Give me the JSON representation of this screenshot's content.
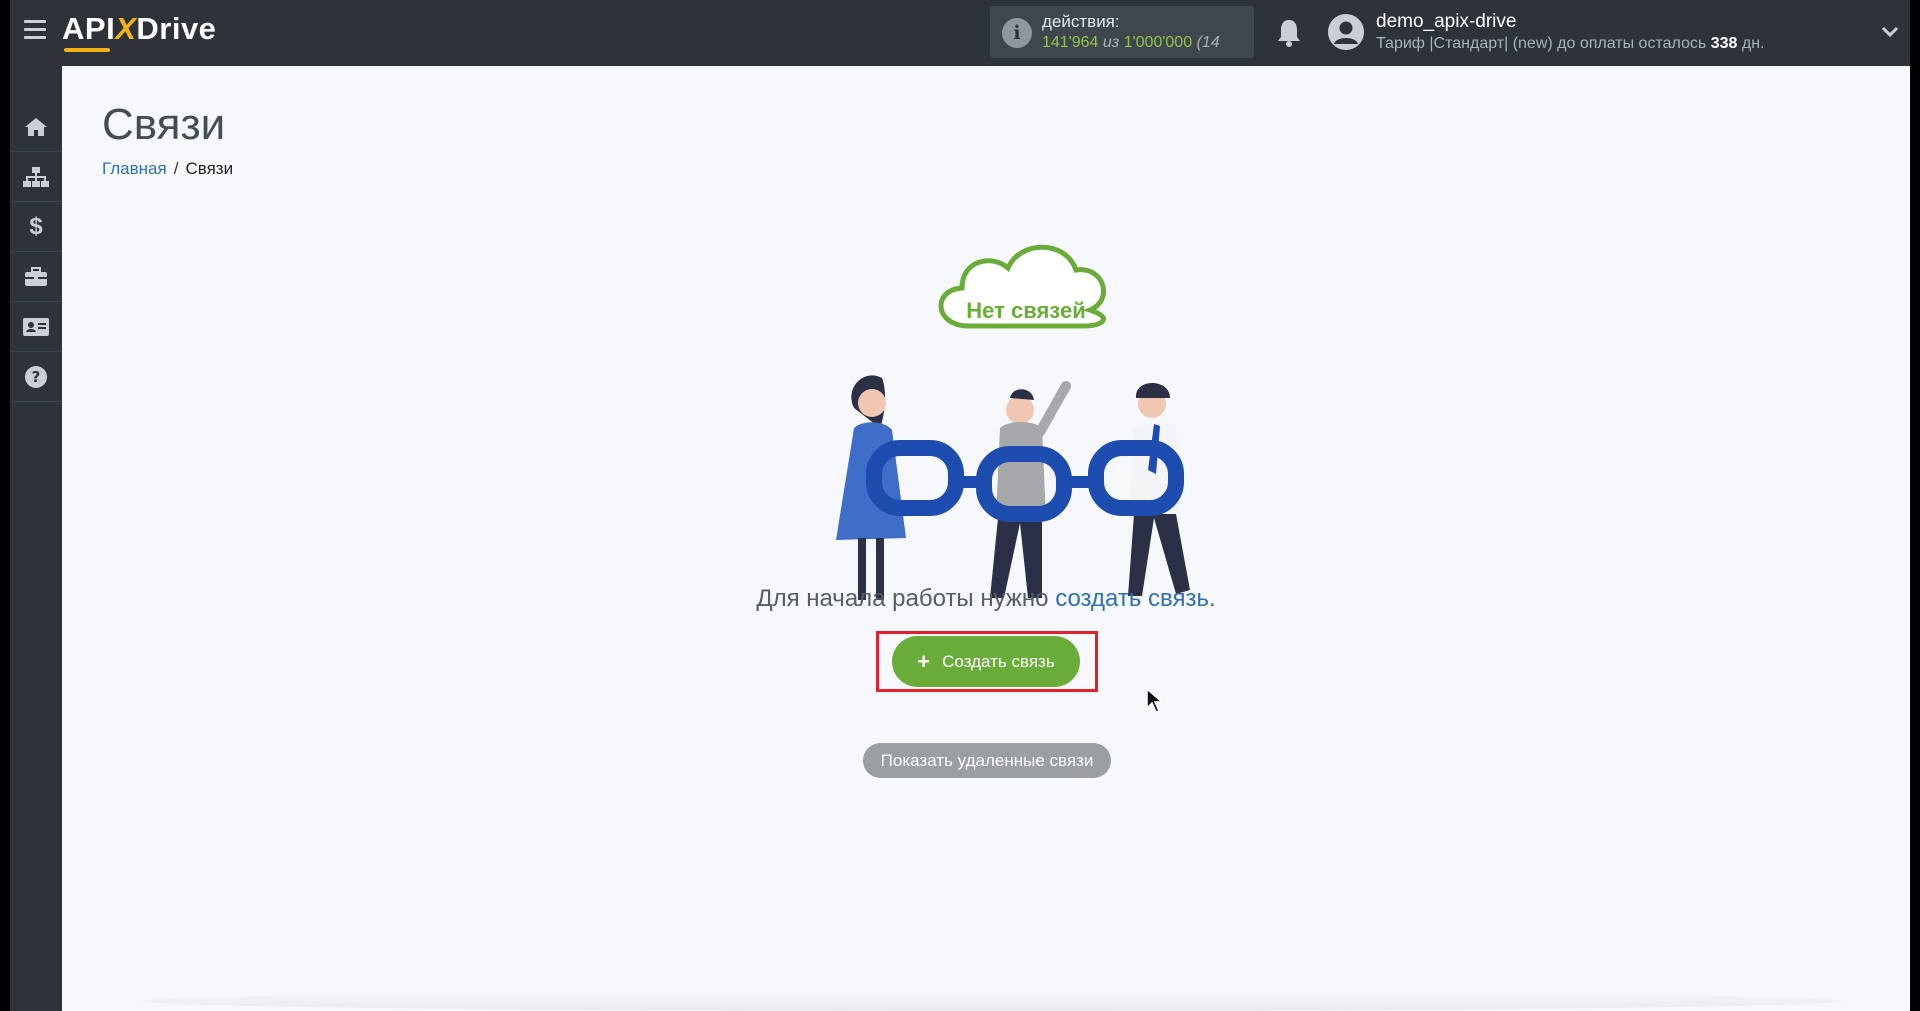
{
  "header": {
    "logo_left": "API",
    "logo_x": "X",
    "logo_right": "Drive",
    "actions_label": "действия:",
    "actions_used": "141'964",
    "actions_of": "из",
    "actions_total": "1'000'000",
    "actions_percent": "(14",
    "username": "demo_apix-drive",
    "tariff_prefix": "Тариф |Стандарт| (new) до оплаты осталось",
    "tariff_days": "338",
    "tariff_suffix": "дн."
  },
  "sidebar": {
    "items": [
      {
        "icon": "home-icon"
      },
      {
        "icon": "sitemap-icon"
      },
      {
        "icon": "dollar-icon"
      },
      {
        "icon": "briefcase-icon"
      },
      {
        "icon": "id-card-icon"
      },
      {
        "icon": "help-icon"
      }
    ]
  },
  "main": {
    "title": "Связи",
    "breadcrumb_home": "Главная",
    "breadcrumb_sep": "/",
    "breadcrumb_current": "Связи",
    "cloud_text": "Нет связей",
    "prompt_text": "Для начала работы нужно",
    "prompt_link": "создать связь",
    "prompt_end": ".",
    "create_button_label": "Создать связь",
    "create_button_icon": "+",
    "deleted_button_label": "Показать удаленные связи"
  },
  "colors": {
    "topbar": "#2d3339",
    "accent_green": "#6aac3a",
    "link_blue": "#2f6fb5",
    "logo_yellow": "#f2b319",
    "highlight_red": "#e3202d"
  }
}
